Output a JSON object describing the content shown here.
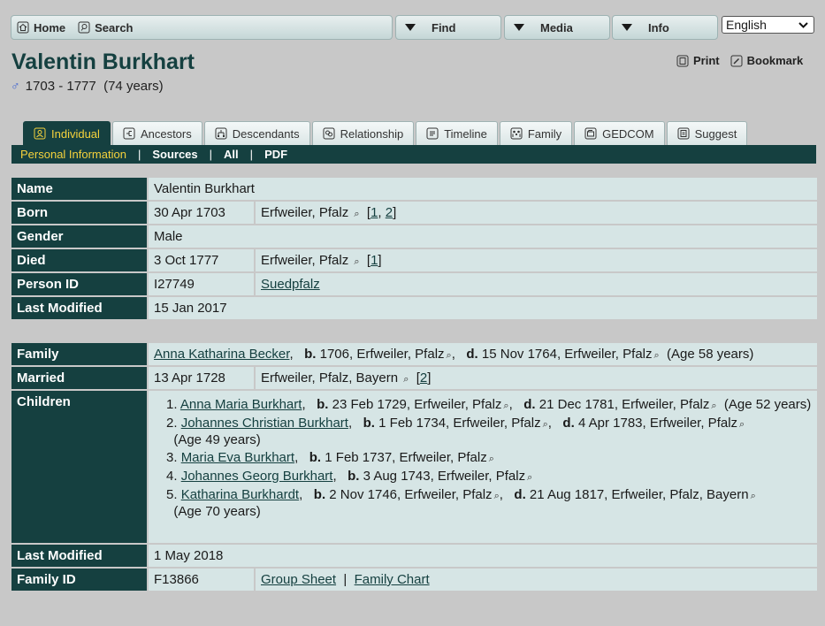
{
  "nav": {
    "home": "Home",
    "search": "Search",
    "find": "Find",
    "media": "Media",
    "info": "Info",
    "language": "English"
  },
  "person": {
    "name": "Valentin Burkhart",
    "gender_symbol": "♂",
    "dates": "1703 - 1777",
    "age": "(74 years)"
  },
  "actions": {
    "print": "Print",
    "bookmark": "Bookmark"
  },
  "tabs": [
    "Individual",
    "Ancestors",
    "Descendants",
    "Relationship",
    "Timeline",
    "Family",
    "GEDCOM",
    "Suggest"
  ],
  "subnav": {
    "personal": "Personal Information",
    "sources": "Sources",
    "all": "All",
    "pdf": "PDF"
  },
  "individual": {
    "name_label": "Name",
    "name": "Valentin Burkhart",
    "born_label": "Born",
    "born_date": "30 Apr 1703",
    "born_place": "Erfweiler, Pfalz",
    "born_src1": "1",
    "born_src2": "2",
    "gender_label": "Gender",
    "gender": "Male",
    "died_label": "Died",
    "died_date": "3 Oct 1777",
    "died_place": "Erfweiler, Pfalz",
    "died_src": "1",
    "pid_label": "Person ID",
    "pid": "I27749",
    "tree": "Suedpfalz",
    "mod_label": "Last Modified",
    "mod": "15 Jan 2017"
  },
  "family": {
    "family_label": "Family",
    "spouse": "Anna Katharina Becker",
    "spouse_b": "1706, Erfweiler, Pfalz",
    "spouse_d": "15 Nov 1764, Erfweiler, Pfalz",
    "spouse_age": "(Age 58 years)",
    "married_label": "Married",
    "married_date": "13 Apr 1728",
    "married_place": "Erfweiler, Pfalz, Bayern",
    "married_src": "2",
    "children_label": "Children",
    "children": [
      {
        "num": "1.",
        "name": "Anna Maria Burkhart",
        "b": "23 Feb 1729, Erfweiler, Pfalz",
        "d": "21 Dec 1781, Erfweiler, Pfalz",
        "age": "(Age 52 years)"
      },
      {
        "num": "2.",
        "name": "Johannes Christian Burkhart",
        "b": "1 Feb 1734, Erfweiler, Pfalz",
        "d": "4 Apr 1783, Erfweiler, Pfalz",
        "age": "(Age 49 years)"
      },
      {
        "num": "3.",
        "name": "Maria Eva Burkhart",
        "b": "1 Feb 1737, Erfweiler, Pfalz",
        "d": "",
        "age": ""
      },
      {
        "num": "4.",
        "name": "Johannes Georg Burkhart",
        "b": "3 Aug 1743, Erfweiler, Pfalz",
        "d": "",
        "age": ""
      },
      {
        "num": "5.",
        "name": "Katharina Burkhardt",
        "b": "2 Nov 1746, Erfweiler, Pfalz",
        "d": "21 Aug 1817, Erfweiler, Pfalz, Bayern",
        "age": "(Age 70 years)"
      }
    ],
    "mod_label": "Last Modified",
    "mod": "1 May 2018",
    "fid_label": "Family ID",
    "fid": "F13866",
    "group_sheet": "Group Sheet",
    "family_chart": "Family Chart"
  },
  "labels": {
    "b": "b.",
    "d": "d."
  }
}
